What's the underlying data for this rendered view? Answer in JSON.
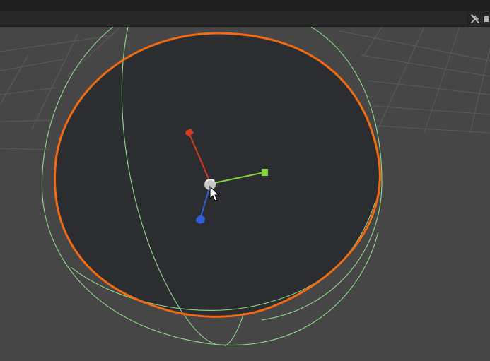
{
  "toolbar": {
    "tools_icon": "wrench-screwdriver-icon",
    "overflow_icon": "panel-menu-icon"
  },
  "viewport": {
    "background_color": "#464646",
    "grid_color": "#5e5e5e",
    "sphere_fill_color": "#2b2d31",
    "selection_outline_color": "#f26b13",
    "collider_color": "#8fd889",
    "gizmo": {
      "x_axis_color": "#7ed43a",
      "y_axis_color": "#d23b1f",
      "z_axis_color": "#2e5fd9",
      "center_color": "#c8c8c8"
    },
    "cursor_icon": "mouse-pointer-icon"
  }
}
